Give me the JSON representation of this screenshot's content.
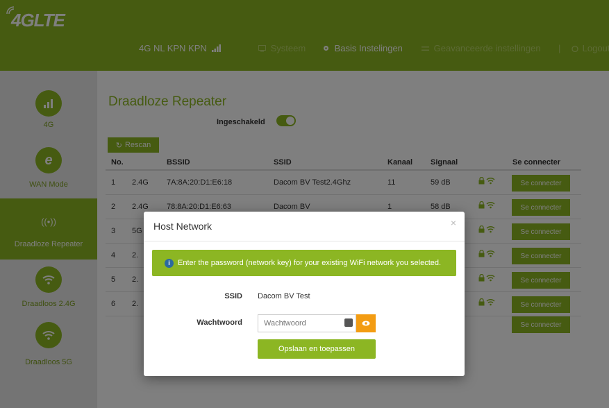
{
  "logo": {
    "text": "4GLTE"
  },
  "nav": {
    "network": "4G  NL KPN KPN",
    "system": "Systeem",
    "basic": "Basis Instelingen",
    "advanced": "Geavanceerde instellingen",
    "divider": "|",
    "logout": "Logout"
  },
  "sidebar": {
    "items": [
      {
        "label": "4G",
        "icon": "signal-bars-icon"
      },
      {
        "label": "WAN Mode",
        "icon": "internet-e-icon"
      },
      {
        "label": "Draadloze Repeater",
        "icon": "antenna-icon"
      },
      {
        "label": "Draadloos 2.4G",
        "icon": "wifi-icon"
      },
      {
        "label": "Draadloos 5G",
        "icon": "wifi-icon"
      }
    ]
  },
  "main": {
    "title": "Draadloze Repeater",
    "enable_label": "Ingeschakeld",
    "rescan_label": "Rescan",
    "columns": {
      "no": "No.",
      "bssid": "BSSID",
      "ssid": "SSID",
      "channel": "Kanaal",
      "signal": "Signaal",
      "connect": "Se connecter"
    },
    "rows": [
      {
        "no": "1",
        "band": "2.4G",
        "bssid": "7A:8A:20:D1:E6:18",
        "ssid": "Dacom BV Test2.4Ghz",
        "channel": "11",
        "signal": "59 dB",
        "button": "Se connecter"
      },
      {
        "no": "2",
        "band": "2.4G",
        "bssid": "78:8A:20:D1:E6:63",
        "ssid": "Dacom BV",
        "channel": "1",
        "signal": "58 dB",
        "button": "Se connecter"
      },
      {
        "no": "3",
        "band": "5G",
        "bssid": "",
        "ssid": "",
        "channel": "",
        "signal": "",
        "button": "Se connecter"
      },
      {
        "no": "4",
        "band": "2.",
        "bssid": "",
        "ssid": "",
        "channel": "",
        "signal": "",
        "button": "Se connecter"
      },
      {
        "no": "5",
        "band": "2.",
        "bssid": "",
        "ssid": "",
        "channel": "",
        "signal": "",
        "button": "Se connecter"
      },
      {
        "no": "6",
        "band": "2.",
        "bssid": "",
        "ssid": "",
        "channel": "",
        "signal": "",
        "button": "Se connecter"
      }
    ],
    "extra_button": "Se connecter"
  },
  "modal": {
    "title": "Host Network",
    "close": "×",
    "alert": "Enter the password (network key) for your existing WiFi network you selected.",
    "ssid_label": "SSID",
    "ssid_value": "Dacom BV Test",
    "password_label": "Wachtwoord",
    "password_placeholder": "Wachtwoord",
    "save_label": "Opslaan en toepassen"
  },
  "colors": {
    "brand": "#8cb623",
    "overlay": "rgba(0,0,0,0.5)",
    "eye_button": "#f39c12"
  }
}
